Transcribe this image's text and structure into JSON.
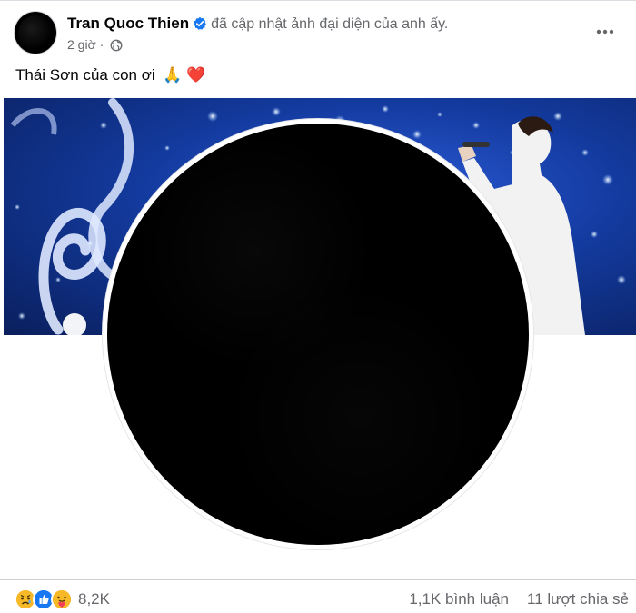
{
  "post": {
    "author": "Tran Quoc Thien",
    "action": "đã cập nhật ảnh đại diện của anh ấy.",
    "time": "2 giờ",
    "separator": "·",
    "caption": "Thái Sơn của con ơi",
    "caption_emojis": "🙏 ❤️"
  },
  "reactions": {
    "icons": [
      "sad-react-icon",
      "like-react-icon",
      "care-react-icon"
    ],
    "count": "8,2K"
  },
  "stats": {
    "comments": "1,1K bình luận",
    "shares": "11 lượt chia sẻ"
  },
  "colors": {
    "like_blue": "#1877f2",
    "verified_blue": "#1877f2",
    "secondary_text": "#65676b"
  }
}
